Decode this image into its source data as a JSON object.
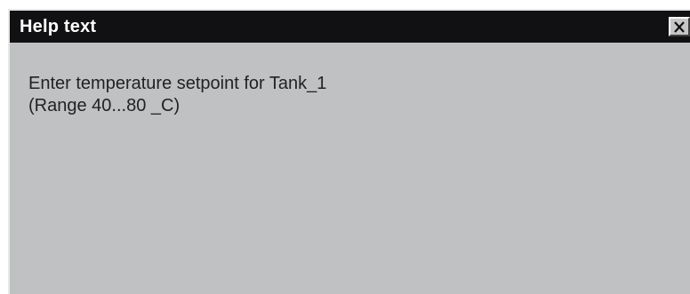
{
  "window": {
    "title": "Help text",
    "close_icon": "close-icon"
  },
  "help": {
    "lines": [
      "Enter temperature setpoint for Tank_1",
      "(Range 40...80 _C)"
    ]
  },
  "colors": {
    "titlebar": "#111113",
    "panel": "#bfc1c3",
    "text": "#222222"
  }
}
